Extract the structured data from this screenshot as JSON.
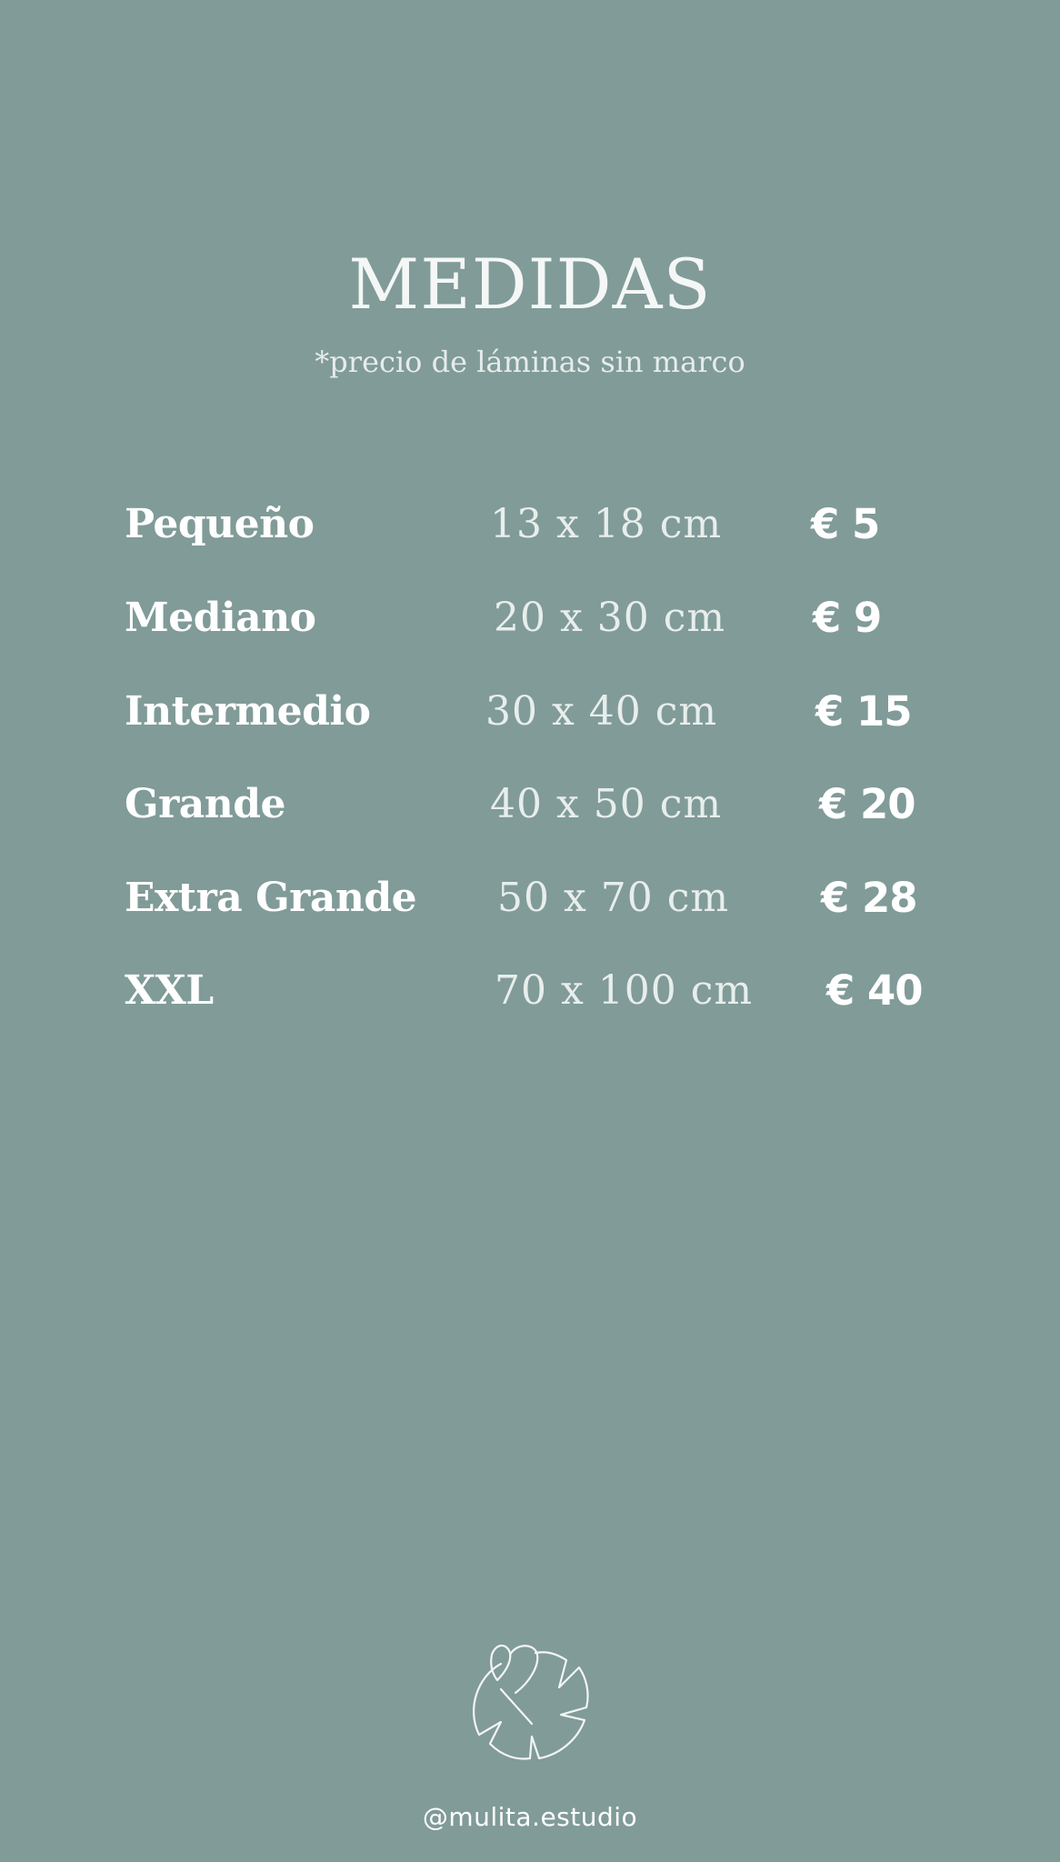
{
  "header": {
    "title": "MEDIDAS",
    "subtitle": "*precio de láminas sin marco"
  },
  "sizes": [
    {
      "name": "Pequeño",
      "dimensions": "13 x 18 cm",
      "price": "€ 5"
    },
    {
      "name": "Mediano",
      "dimensions": "20 x 30 cm",
      "price": "€ 9"
    },
    {
      "name": "Intermedio",
      "dimensions": "30 x 40 cm",
      "price": "€ 15"
    },
    {
      "name": "Grande",
      "dimensions": "40 x 50 cm",
      "price": "€ 20"
    },
    {
      "name": "Extra Grande",
      "dimensions": "50 x 70 cm",
      "price": "€ 28"
    },
    {
      "name": "XXL",
      "dimensions": "70 x 100 cm",
      "price": "€ 40"
    }
  ],
  "footer": {
    "logo_icon": "monstera-leaf-icon",
    "handle": "@mulita.estudio"
  },
  "colors": {
    "background": "#809b98",
    "text": "#ffffff"
  }
}
